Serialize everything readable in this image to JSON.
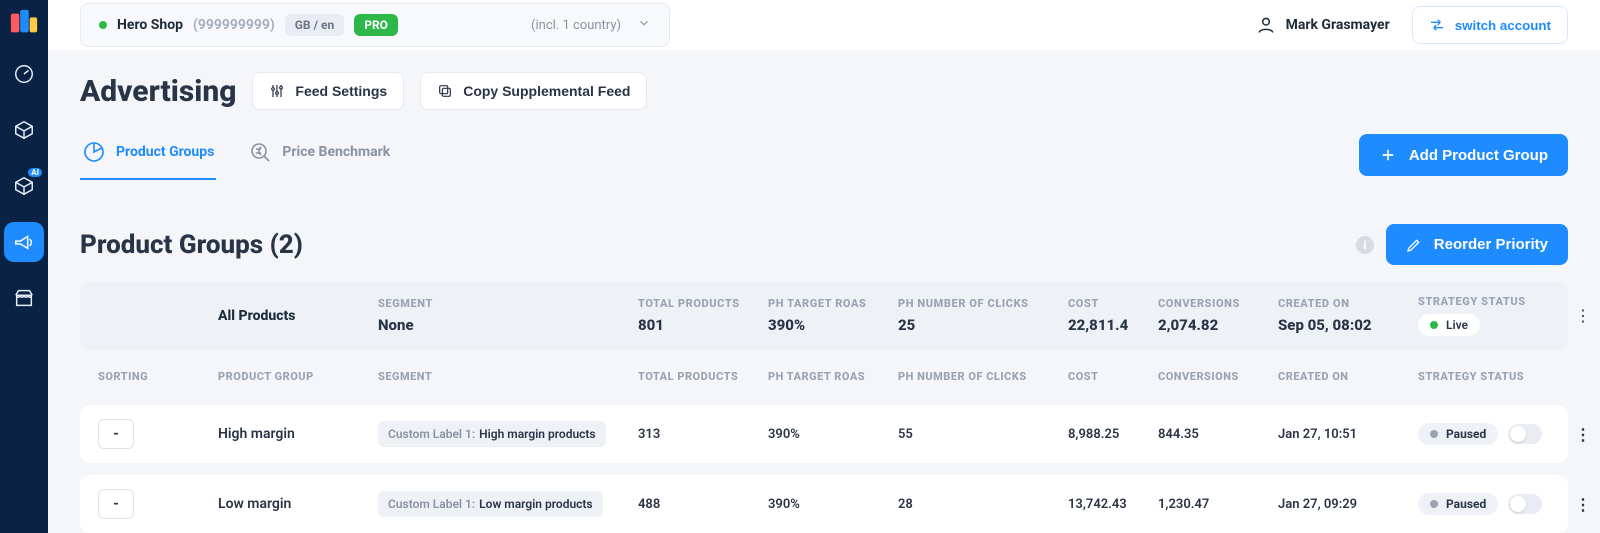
{
  "nav": {
    "items": [
      "dashboard",
      "products",
      "ai-products",
      "advertising",
      "storefront"
    ]
  },
  "topbar": {
    "store_name": "Hero Shop",
    "store_id": "(999999999)",
    "locale": "GB / en",
    "plan_badge": "PRO",
    "country_note": "(incl. 1 country)",
    "user_name": "Mark Grasmayer",
    "switch_label": "switch account"
  },
  "page": {
    "title": "Advertising",
    "feed_settings_btn": "Feed Settings",
    "copy_feed_btn": "Copy Supplemental Feed",
    "tabs": [
      {
        "label": "Product Groups",
        "active": true
      },
      {
        "label": "Price Benchmark",
        "active": false
      }
    ],
    "add_group_btn": "Add Product Group",
    "section_title": "Product Groups",
    "group_count": "(2)",
    "reorder_btn": "Reorder Priority"
  },
  "summary": {
    "all_products_label": "All Products",
    "cols": {
      "segment_hd": "SEGMENT",
      "segment_val": "None",
      "total_hd": "TOTAL PRODUCTS",
      "total_val": "801",
      "roas_hd": "PH TARGET ROAS",
      "roas_val": "390%",
      "clicks_hd": "PH NUMBER OF CLICKS",
      "clicks_val": "25",
      "cost_hd": "COST",
      "cost_val": "22,811.4",
      "conv_hd": "CONVERSIONS",
      "conv_val": "2,074.82",
      "created_hd": "CREATED ON",
      "created_val": "Sep 05, 08:02",
      "status_hd": "STRATEGY STATUS",
      "status_val": "Live"
    }
  },
  "table": {
    "headers": {
      "sorting": "SORTING",
      "group": "PRODUCT GROUP",
      "segment": "SEGMENT",
      "total": "TOTAL PRODUCTS",
      "roas": "PH TARGET ROAS",
      "clicks": "PH NUMBER OF CLICKS",
      "cost": "COST",
      "conv": "CONVERSIONS",
      "created": "CREATED ON",
      "status": "STRATEGY STATUS"
    },
    "rows": [
      {
        "sort": "-",
        "name": "High margin",
        "seg_key": "Custom Label 1:",
        "seg_val": "High margin products",
        "total": "313",
        "roas": "390%",
        "clicks": "55",
        "cost": "8,988.25",
        "conv": "844.35",
        "created": "Jan 27, 10:51",
        "status": "Paused"
      },
      {
        "sort": "-",
        "name": "Low margin",
        "seg_key": "Custom Label 1:",
        "seg_val": "Low margin products",
        "total": "488",
        "roas": "390%",
        "clicks": "28",
        "cost": "13,742.43",
        "conv": "1,230.47",
        "created": "Jan 27, 09:29",
        "status": "Paused"
      }
    ]
  }
}
